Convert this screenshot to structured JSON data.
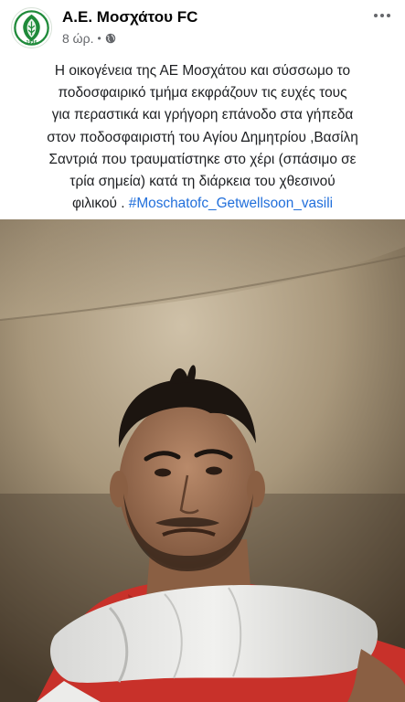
{
  "header": {
    "page_name": "Α.Ε. Μοσχάτου FC",
    "time_ago": "8 ώρ.",
    "separator": "•",
    "logo_text": "1936"
  },
  "icons": {
    "privacy": "globe-icon",
    "more": "more-options-icon"
  },
  "post": {
    "caption_lines": [
      "Η οικογένεια της ΑΕ Μοσχάτου και σύσσωμο το",
      "ποδοσφαιρικό τμήμα εκφράζουν τις ευχές τους",
      "για περαστικά και γρήγορη επάνοδο στα γήπεδα",
      "στον ποδοσφαιριστή του Αγίου Δημητρίου ,Βασίλη",
      "Σαντριά που τραυματίστηκε στο χέρι (σπάσιμο σε",
      "τρία σημεία) κατά τη διάρκεια του χθεσινού"
    ],
    "caption_last": "φιλικού . ",
    "hashtag": "#Moschatofc_Getwellsoon_vasili"
  },
  "colors": {
    "brand_green": "#1f8a3a",
    "link_blue": "#216fdb",
    "meta_gray": "#65676b"
  }
}
